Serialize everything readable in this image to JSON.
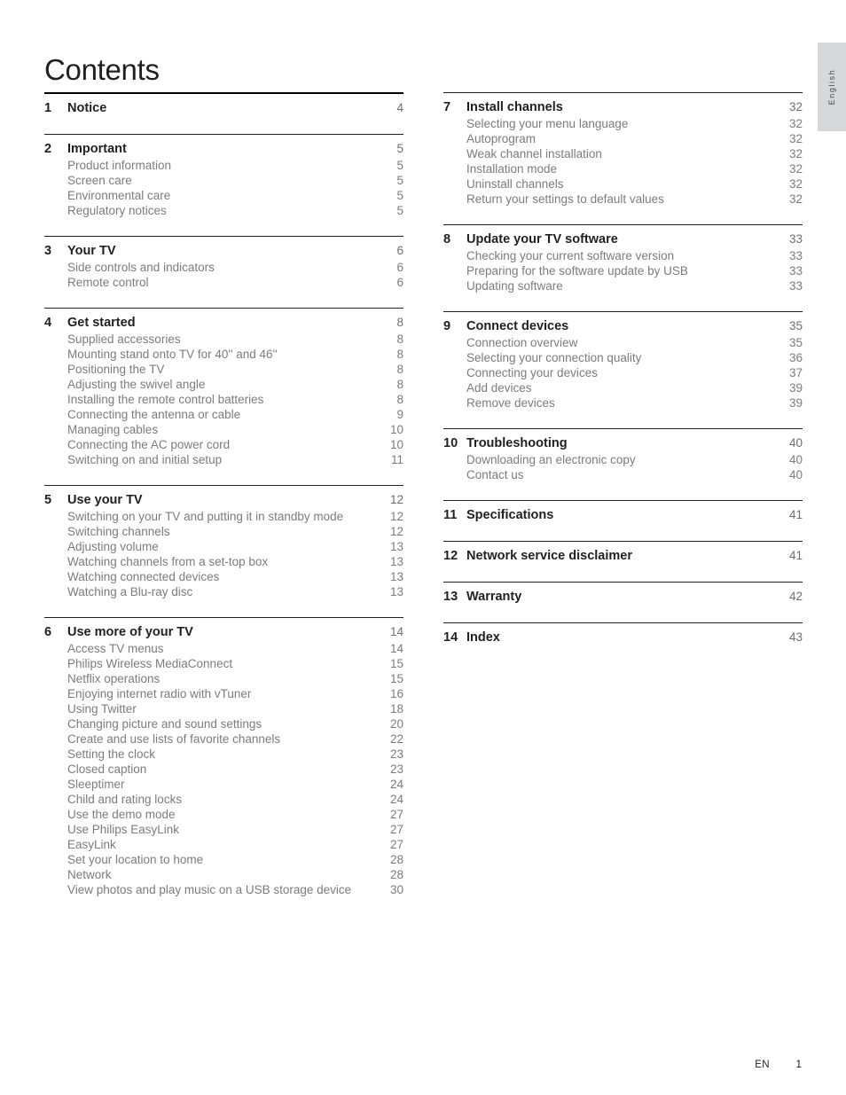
{
  "page_title": "Contents",
  "side_tab": {
    "language": "English"
  },
  "footer": {
    "language_code": "EN",
    "page_number": "1"
  },
  "columns": {
    "left": [
      {
        "number": "1",
        "title": "Notice",
        "page": "4",
        "rule": "thick",
        "entries": []
      },
      {
        "number": "2",
        "title": "Important",
        "page": "5",
        "rule": "thin",
        "entries": [
          {
            "label": "Product information",
            "page": "5"
          },
          {
            "label": "Screen care",
            "page": "5"
          },
          {
            "label": "Environmental care",
            "page": "5"
          },
          {
            "label": "Regulatory notices",
            "page": "5"
          }
        ]
      },
      {
        "number": "3",
        "title": "Your TV",
        "page": "6",
        "rule": "thin",
        "entries": [
          {
            "label": "Side controls and indicators",
            "page": "6"
          },
          {
            "label": "Remote control",
            "page": "6"
          }
        ]
      },
      {
        "number": "4",
        "title": "Get started",
        "page": "8",
        "rule": "thin",
        "entries": [
          {
            "label": "Supplied accessories",
            "page": "8"
          },
          {
            "label": "Mounting stand onto TV for 40'' and 46''",
            "page": "8"
          },
          {
            "label": "Positioning the TV",
            "page": "8"
          },
          {
            "label": "Adjusting the swivel angle",
            "page": "8"
          },
          {
            "label": "Installing the remote control batteries",
            "page": "8"
          },
          {
            "label": "Connecting the antenna or cable",
            "page": "9"
          },
          {
            "label": "Managing cables",
            "page": "10"
          },
          {
            "label": "Connecting the AC power cord",
            "page": "10"
          },
          {
            "label": "Switching on and initial setup",
            "page": "11"
          }
        ]
      },
      {
        "number": "5",
        "title": "Use your TV",
        "page": "12",
        "rule": "thin",
        "entries": [
          {
            "label": "Switching on your TV and putting it in standby mode",
            "page": "12"
          },
          {
            "label": "Switching channels",
            "page": "12"
          },
          {
            "label": "Adjusting volume",
            "page": "13"
          },
          {
            "label": "Watching channels from a set-top box",
            "page": "13"
          },
          {
            "label": "Watching connected devices",
            "page": "13"
          },
          {
            "label": "Watching a Blu-ray disc",
            "page": "13"
          }
        ]
      },
      {
        "number": "6",
        "title": "Use more of your TV",
        "page": "14",
        "rule": "thin",
        "entries": [
          {
            "label": "Access TV menus",
            "page": "14"
          },
          {
            "label": "Philips Wireless MediaConnect",
            "page": "15"
          },
          {
            "label": "Netflix operations",
            "page": "15"
          },
          {
            "label": "Enjoying internet radio with vTuner",
            "page": "16"
          },
          {
            "label": "Using Twitter",
            "page": "18"
          },
          {
            "label": "Changing picture and sound settings",
            "page": "20"
          },
          {
            "label": "Create and use lists of favorite channels",
            "page": "22"
          },
          {
            "label": "Setting the clock",
            "page": "23"
          },
          {
            "label": "Closed caption",
            "page": "23"
          },
          {
            "label": "Sleeptimer",
            "page": "24"
          },
          {
            "label": "Child and rating locks",
            "page": "24"
          },
          {
            "label": "Use the demo mode",
            "page": "27"
          },
          {
            "label": "Use Philips EasyLink",
            "page": "27"
          },
          {
            "label": "EasyLink",
            "page": "27"
          },
          {
            "label": "Set your location to home",
            "page": "28"
          },
          {
            "label": "Network",
            "page": "28"
          },
          {
            "label": "View photos and play music on a USB storage device",
            "page": "30"
          }
        ]
      }
    ],
    "right": [
      {
        "number": "7",
        "title": "Install channels",
        "page": "32",
        "rule": "thin",
        "entries": [
          {
            "label": "Selecting your menu language",
            "page": "32"
          },
          {
            "label": "Autoprogram",
            "page": "32"
          },
          {
            "label": "Weak channel installation",
            "page": "32"
          },
          {
            "label": "Installation mode",
            "page": "32"
          },
          {
            "label": "Uninstall channels",
            "page": "32"
          },
          {
            "label": "Return your settings to default values",
            "page": "32"
          }
        ]
      },
      {
        "number": "8",
        "title": "Update your TV software",
        "page": "33",
        "rule": "thin",
        "entries": [
          {
            "label": "Checking your current software version",
            "page": "33"
          },
          {
            "label": "Preparing for the software update by USB",
            "page": "33"
          },
          {
            "label": "Updating software",
            "page": "33"
          }
        ]
      },
      {
        "number": "9",
        "title": "Connect devices",
        "page": "35",
        "rule": "thin",
        "entries": [
          {
            "label": "Connection overview",
            "page": "35"
          },
          {
            "label": "Selecting your connection quality",
            "page": "36"
          },
          {
            "label": "Connecting your devices",
            "page": "37"
          },
          {
            "label": "Add devices",
            "page": "39"
          },
          {
            "label": "Remove devices",
            "page": "39"
          }
        ]
      },
      {
        "number": "10",
        "title": "Troubleshooting",
        "page": "40",
        "rule": "thin",
        "entries": [
          {
            "label": "Downloading an electronic copy",
            "page": "40"
          },
          {
            "label": "Contact us",
            "page": "40"
          }
        ]
      },
      {
        "number": "11",
        "title": "Specifications",
        "page": "41",
        "rule": "thin",
        "entries": []
      },
      {
        "number": "12",
        "title": "Network service disclaimer",
        "page": "41",
        "rule": "thin",
        "entries": []
      },
      {
        "number": "13",
        "title": "Warranty",
        "page": "42",
        "rule": "thin",
        "entries": []
      },
      {
        "number": "14",
        "title": "Index",
        "page": "43",
        "rule": "thin",
        "entries": []
      }
    ]
  }
}
